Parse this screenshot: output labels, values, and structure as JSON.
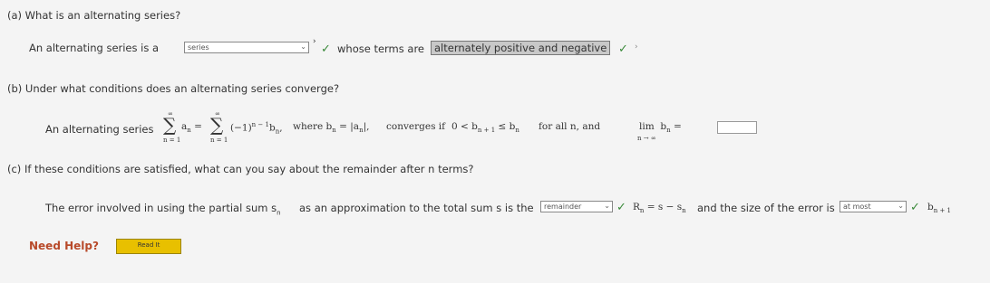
{
  "part_a": {
    "question": "(a)  What is an alternating series?",
    "sentence_start": "An alternating series is a",
    "select_value": "series",
    "sentence_mid": "whose terms are",
    "answer": "alternately positive and negative"
  },
  "part_b": {
    "question": "(b)  Under what conditions does an alternating series converge?",
    "lead": "An alternating series",
    "where_text": "where b",
    "converges_text": "converges if",
    "forall_text": "for all n, and",
    "lim_text": "lim"
  },
  "part_c": {
    "question": "(c)  If these conditions are satisfied, what can you say about the remainder after n terms?",
    "sentence_start": "The error involved in using the partial sum s",
    "sentence_mid": "as an approximation to the total sum s is the",
    "select1": "remainder",
    "formula": "R",
    "sentence_end": "and the size of the error is",
    "select2": "at most"
  },
  "help": {
    "label": "Need Help?",
    "button": "Read It"
  },
  "colors": {
    "check": "#3a8a3a",
    "help_button": "#e8c000",
    "help_text": "#b84a2a"
  }
}
